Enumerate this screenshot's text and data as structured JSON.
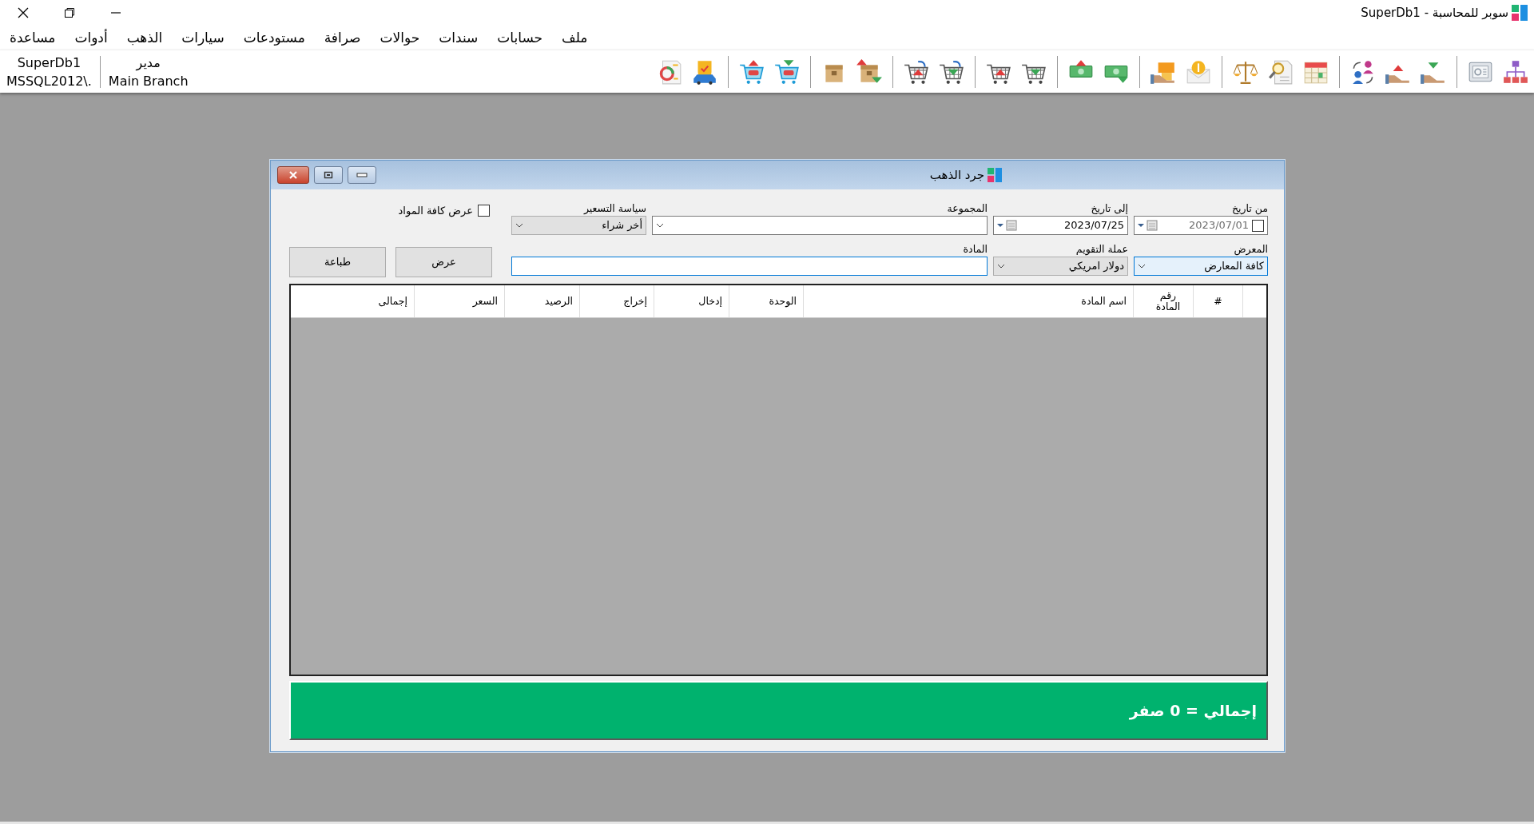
{
  "window": {
    "title": "سوبر للمحاسبة - SuperDb1"
  },
  "menu": [
    "ملف",
    "حسابات",
    "سندات",
    "حوالات",
    "صرافة",
    "مستودعات",
    "سيارات",
    "الذهب",
    "أدوات",
    "مساعدة"
  ],
  "connection": {
    "database": "SuperDb1",
    "server": "MSSQL2012\\.",
    "user": "مدير",
    "branch": "Main Branch"
  },
  "dialog": {
    "title": "جرد الذهب",
    "from_date": {
      "label": "من تاريخ",
      "value": "2023/07/01",
      "checked": false
    },
    "to_date": {
      "label": "إلى تاريخ",
      "value": "2023/07/25"
    },
    "group": {
      "label": "المجموعة"
    },
    "pricing_policy": {
      "label": "سياسة التسعير",
      "value": "أخر شراء"
    },
    "show_all": {
      "label": "عرض كافة المواد",
      "checked": false
    },
    "exhibit": {
      "label": "المعرض",
      "value": "كافة المعارض"
    },
    "currency": {
      "label": "عملة التقويم",
      "value": "دولار امريكي"
    },
    "material": {
      "label": "المادة"
    },
    "buttons": [
      "عرض",
      "طباعة"
    ],
    "table": {
      "columns": [
        "#",
        "رقم المادة",
        "اسم المادة",
        "الوحدة",
        "إدخال",
        "إخراج",
        "الرصيد",
        "السعر",
        "إجمالى"
      ]
    },
    "total": "إجمالي = 0 صفر"
  }
}
